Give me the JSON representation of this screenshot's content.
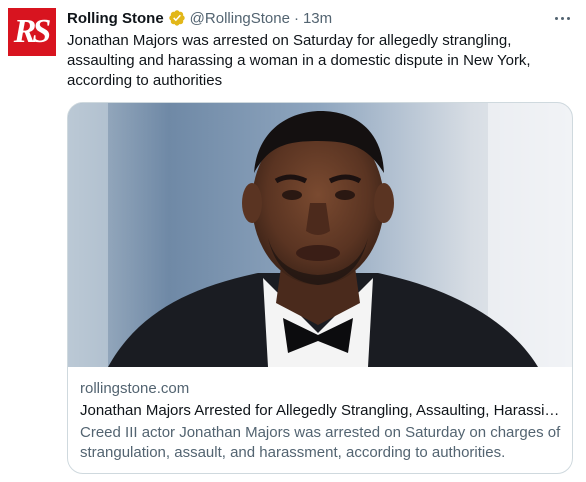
{
  "tweet": {
    "avatar_text": "RS",
    "display_name": "Rolling Stone",
    "handle": "@RollingStone",
    "separator": "·",
    "time": "13m",
    "verified_badge": "gold-verified-badge-icon",
    "text": "Jonathan Majors was arrested on Saturday for allegedly strangling, assaulting and harassing a woman in a domestic dispute in New York, according to authorities"
  },
  "card": {
    "domain": "rollingstone.com",
    "title": "Jonathan Majors Arrested for Allegedly Strangling, Assaulting, Harassing Woman",
    "description": "Creed III actor Jonathan Majors was arrested on Saturday on charges of strangulation, assault, and harassment, according to authorities."
  },
  "colors": {
    "brand_red": "#d8141f",
    "verified_gold": "#e2b719",
    "secondary_text": "#536471",
    "border": "#cfd9de"
  }
}
